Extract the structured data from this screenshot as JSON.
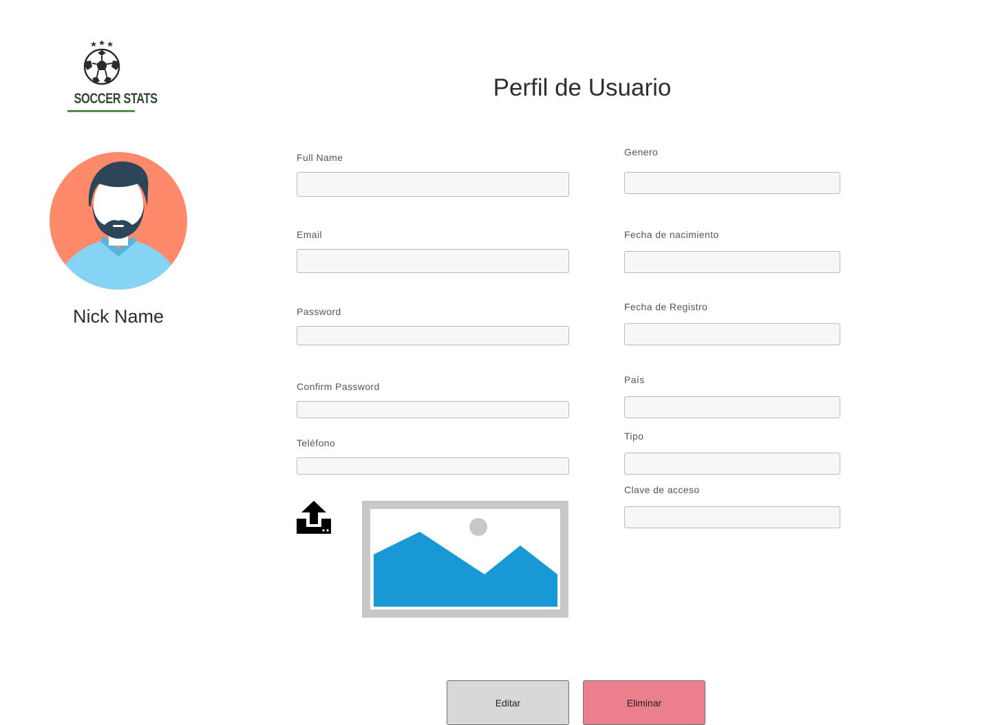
{
  "brand": {
    "logo_text": "SOCCER STATS",
    "colors": {
      "text": "#2f4a2f",
      "underline": "#4f8f47"
    }
  },
  "profile": {
    "nickname": "Nick Name",
    "avatar_colors": {
      "background": "#fe8a6b",
      "shirt": "#85d4f6",
      "hair": "#2d4558"
    }
  },
  "page": {
    "title": "Perfil de Usuario"
  },
  "form": {
    "full_name": {
      "label": "Full Name",
      "value": "",
      "placeholder": ""
    },
    "email": {
      "label": "Email",
      "value": "",
      "placeholder": ""
    },
    "password": {
      "label": "Password",
      "value": "",
      "placeholder": ""
    },
    "confirm_password": {
      "label": "Confirm Password",
      "value": "",
      "placeholder": ""
    },
    "telefono": {
      "label": "Teléfono",
      "value": "",
      "placeholder": ""
    },
    "genero": {
      "label": "Genero",
      "value": "",
      "placeholder": ""
    },
    "fecha_nacimiento": {
      "label": "Fecha de nacimiento",
      "value": "",
      "placeholder": ""
    },
    "fecha_registro": {
      "label": "Fecha de Registro",
      "value": "",
      "placeholder": ""
    },
    "pais": {
      "label": "País",
      "value": "",
      "placeholder": ""
    },
    "tipo": {
      "label": "Tipo",
      "value": "",
      "placeholder": ""
    },
    "clave_acceso": {
      "label": "Clave de acceso",
      "value": "",
      "placeholder": ""
    }
  },
  "upload": {
    "icon": "upload-icon",
    "preview_icon": "image-placeholder-icon",
    "colors": {
      "frame": "#c8c8c8",
      "mountains": "#1898d4",
      "sun": "#c8c8c8"
    }
  },
  "actions": {
    "edit_label": "Editar",
    "delete_label": "Eliminar",
    "colors": {
      "edit": "#d8d8d8",
      "delete": "#eb7f8b"
    }
  }
}
